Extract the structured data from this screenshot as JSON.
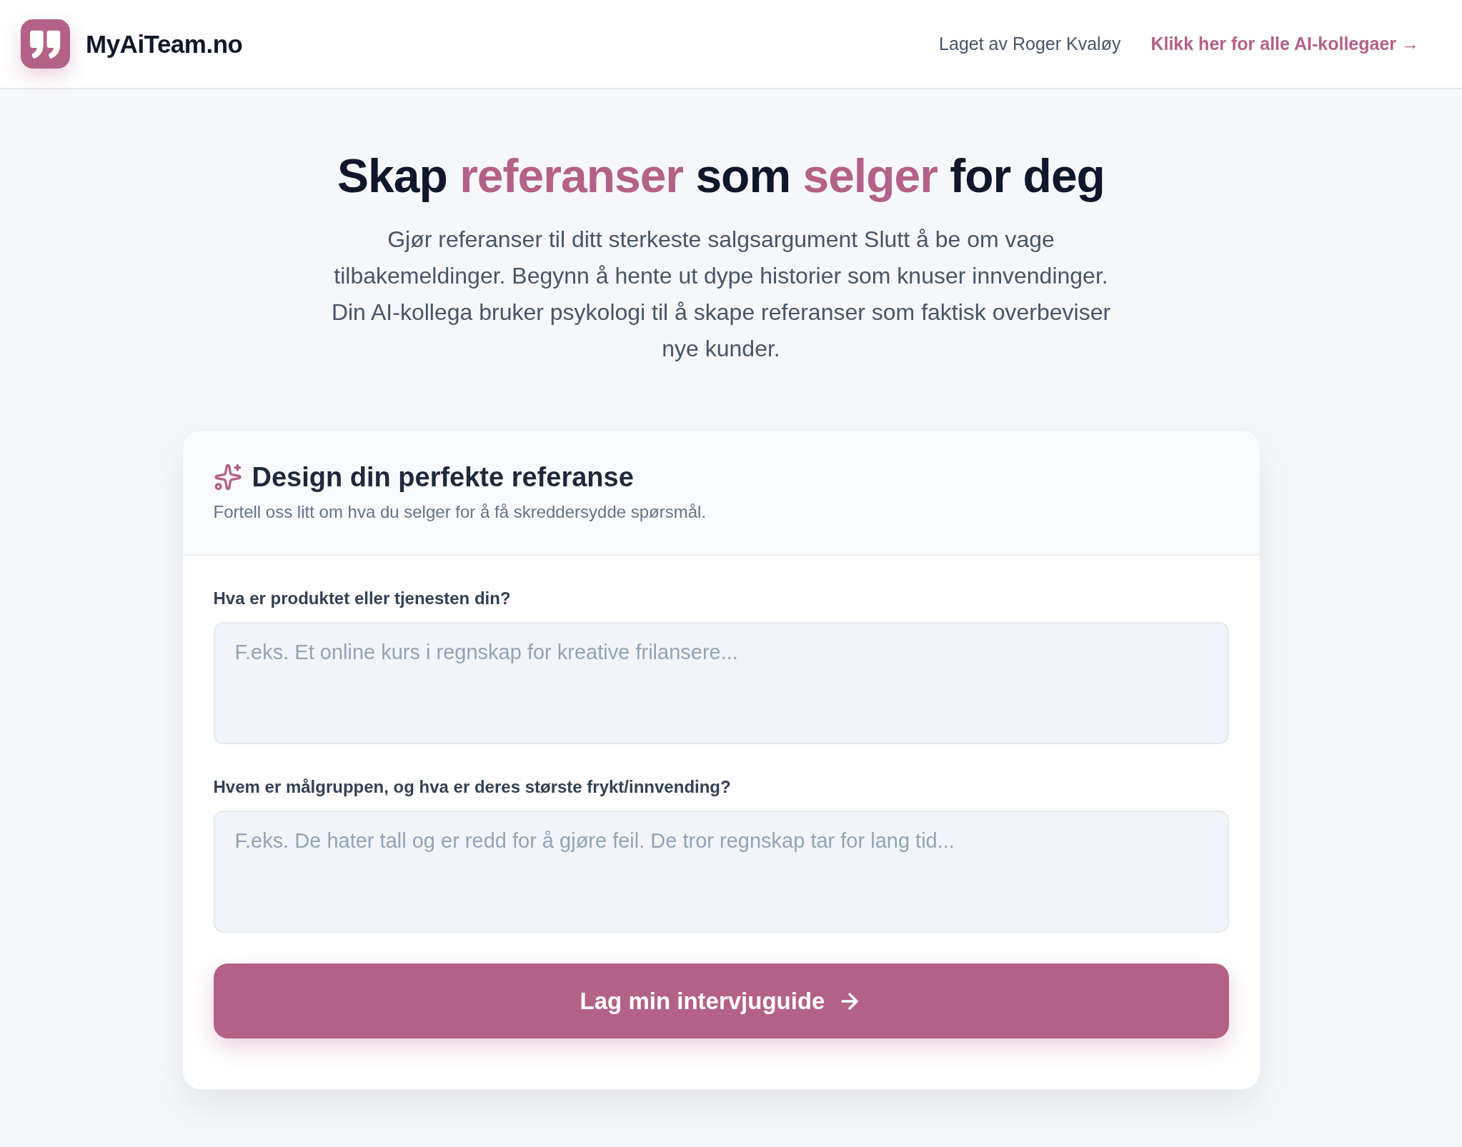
{
  "header": {
    "logo_text": "MyAiTeam.no",
    "credit": "Laget av Roger Kvaløy",
    "link": "Klikk her for alle AI-kollegaer →"
  },
  "hero": {
    "title": [
      {
        "text": "Skap ",
        "accent": false
      },
      {
        "text": "referanser",
        "accent": true
      },
      {
        "text": " som ",
        "accent": false
      },
      {
        "text": "selger",
        "accent": true
      },
      {
        "text": " for deg",
        "accent": false
      }
    ],
    "subtitle": "Gjør referanser til ditt sterkeste salgsargument Slutt å be om vage tilbakemeldinger. Begynn å hente ut dype historier som knuser innvendinger. Din AI-kollega bruker psykologi til å skape referanser som faktisk overbeviser nye kunder."
  },
  "card": {
    "title": "Design din perfekte referanse",
    "subtitle": "Fortell oss litt om hva du selger for å få skreddersydde spørsmål.",
    "fields": [
      {
        "label": "Hva er produktet eller tjenesten din?",
        "placeholder": "F.eks. Et online kurs i regnskap for kreative frilansere..."
      },
      {
        "label": "Hvem er målgruppen, og hva er deres største frykt/innvending?",
        "placeholder": "F.eks. De hater tall og er redd for å gjøre feil. De tror regnskap tar for lang tid..."
      }
    ],
    "submit": "Lag min intervjuguide"
  }
}
